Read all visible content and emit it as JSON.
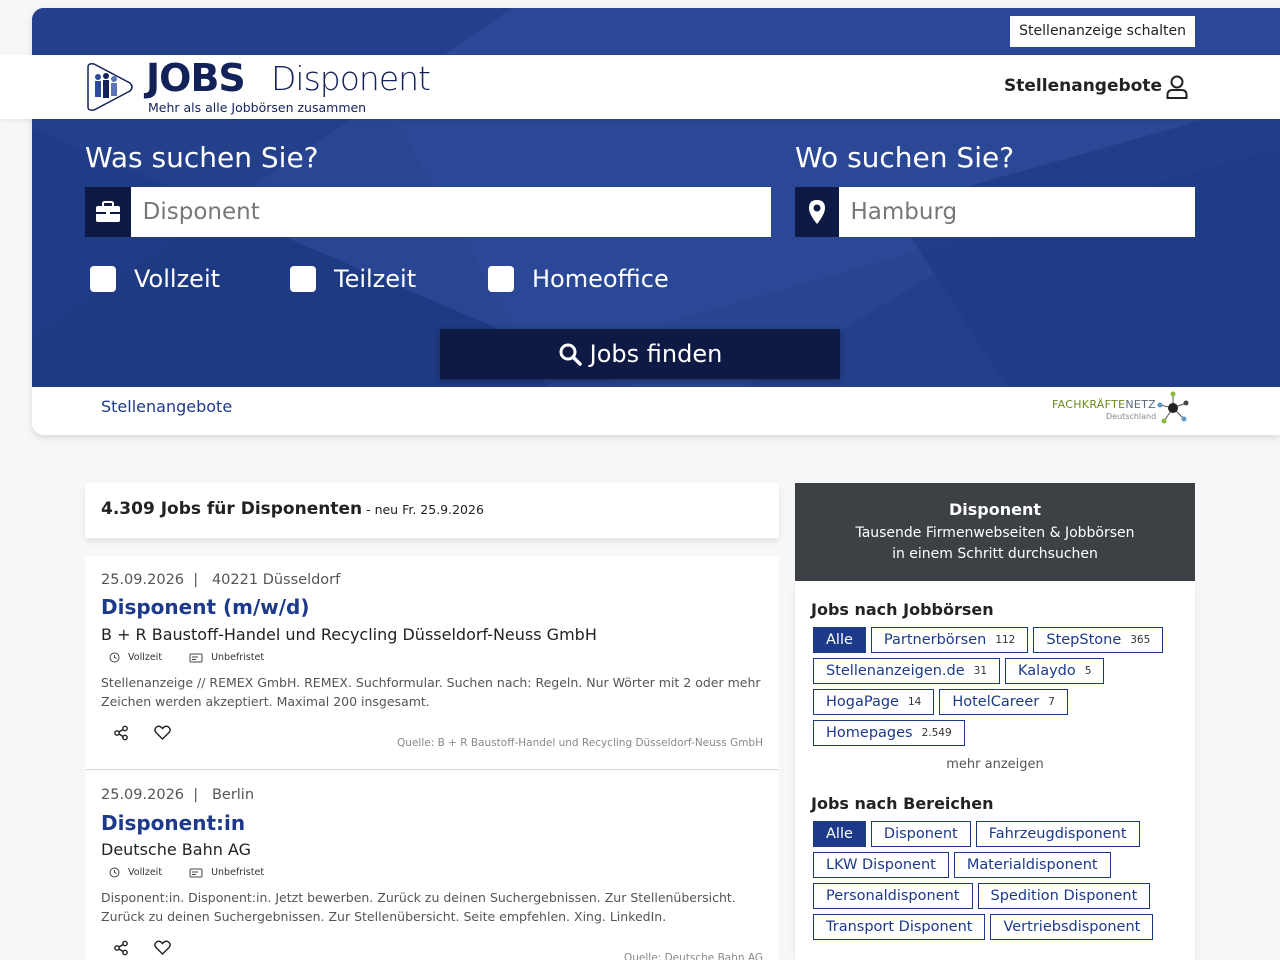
{
  "header": {
    "cta": "Stellenanzeige schalten",
    "logo_jobs": "JOBS",
    "logo_disp": "Disponent",
    "tagline": "Mehr als alle Jobbörsen zusammen",
    "nav_link": "Stellenangebote"
  },
  "search": {
    "what_label": "Was suchen Sie?",
    "what_value": "Disponent",
    "where_label": "Wo suchen Sie?",
    "where_value": "Hamburg",
    "checkboxes": [
      "Vollzeit",
      "Teilzeit",
      "Homeoffice"
    ],
    "button": "Jobs finden"
  },
  "subnav": {
    "link": "Stellenangebote",
    "partner_a": "FACHKRÄFTE",
    "partner_b": "NETZ",
    "partner_sub": "Deutschland"
  },
  "results": {
    "count": "4.309 Jobs für Disponenten",
    "neu": " - neu Fr. 25.9.2026",
    "jobs": [
      {
        "meta": "25.09.2026  |   40221 Düsseldorf",
        "title": "Disponent (m/w/d)",
        "company": "B + R Baustoff-Handel und Recycling Düsseldorf-Neuss GmbH",
        "tag1": "Vollzeit",
        "tag2": "Unbefristet",
        "desc": "Stellenanzeige // REMEX GmbH. REMEX. Suchformular. Suchen nach: Regeln. Nur Wörter mit 2 oder mehr Zeichen werden akzeptiert. Maximal 200 insgesamt.",
        "source": "Quelle: B + R Baustoff-Handel und Recycling Düsseldorf-Neuss GmbH"
      },
      {
        "meta": "25.09.2026  |   Berlin",
        "title": "Disponent:in",
        "company": "Deutsche Bahn AG",
        "tag1": "Vollzeit",
        "tag2": "Unbefristet",
        "desc": "Disponent:in. Disponent:in. Jetzt bewerben. Zurück zu deinen Suchergebnissen. Zur Stellenübersicht. Zurück zu deinen Suchergebnissen. Zur Stellenübersicht. Seite empfehlen. Xing. LinkedIn.",
        "source": "Quelle: Deutsche Bahn AG"
      }
    ]
  },
  "sidebar": {
    "title": "Disponent",
    "sub1": "Tausende Firmenwebseiten & Jobbörsen",
    "sub2": "in einem Schritt durchsuchen",
    "boersen_title": "Jobs nach Jobbörsen",
    "boersen": [
      {
        "label": "Alle",
        "count": ""
      },
      {
        "label": "Partnerbörsen",
        "count": "112"
      },
      {
        "label": "StepStone",
        "count": "365"
      },
      {
        "label": "Stellenanzeigen.de",
        "count": "31"
      },
      {
        "label": "Kalaydo",
        "count": "5"
      },
      {
        "label": "HogaPage",
        "count": "14"
      },
      {
        "label": "HotelCareer",
        "count": "7"
      },
      {
        "label": "Homepages",
        "count": "2.549"
      }
    ],
    "more": "mehr anzeigen",
    "bereiche_title": "Jobs nach Bereichen",
    "bereiche": [
      "Alle",
      "Disponent",
      "Fahrzeugdisponent",
      "LKW Disponent",
      "Materialdisponent",
      "Personaldisponent",
      "Spedition Disponent",
      "Transport Disponent",
      "Vertriebsdisponent"
    ]
  },
  "colors": {
    "brand_dark": "#0f1a44",
    "brand_blue": "#1d3a8a",
    "hero_blue": "#25408a"
  }
}
